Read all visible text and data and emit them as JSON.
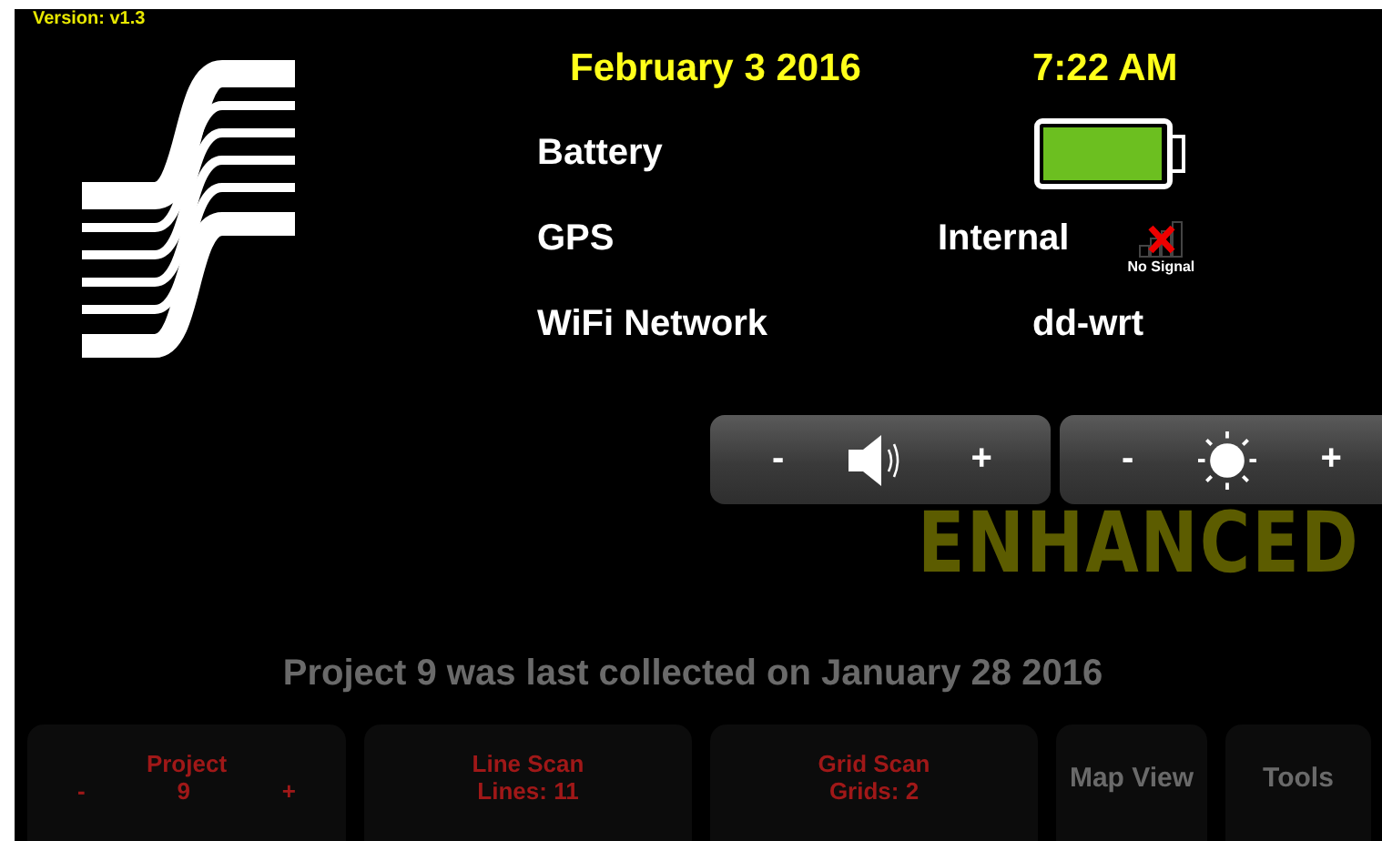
{
  "version": "Version: v1.3",
  "date": "February 3 2016",
  "time": "7:22 AM",
  "status": [
    {
      "kind": "battery",
      "label": "Battery",
      "level": 1
    },
    {
      "kind": "gps",
      "label": "GPS",
      "value": "Internal",
      "signal_text": "No Signal"
    },
    {
      "kind": "wifi",
      "label": "WiFi Network",
      "value": "dd-wrt"
    }
  ],
  "adjusters": [
    {
      "kind": "volume",
      "minus": "-",
      "plus": "+"
    },
    {
      "kind": "brightness",
      "minus": "-",
      "plus": "+"
    }
  ],
  "background": {
    "logo_text": "ENHANCED",
    "message": "Project 9 was last collected on January 28 2016",
    "buttons": [
      {
        "kind": "stepper",
        "title": "Project",
        "minus": "-",
        "value": "9",
        "plus": "+"
      },
      {
        "kind": "scan",
        "lines": [
          "Line Scan",
          "Lines: 11"
        ]
      },
      {
        "kind": "scan",
        "lines": [
          "Grid Scan",
          "Grids: 2"
        ]
      },
      {
        "kind": "nav",
        "lines": [
          "Map View"
        ]
      },
      {
        "kind": "nav",
        "lines": [
          "Tools"
        ]
      }
    ]
  }
}
